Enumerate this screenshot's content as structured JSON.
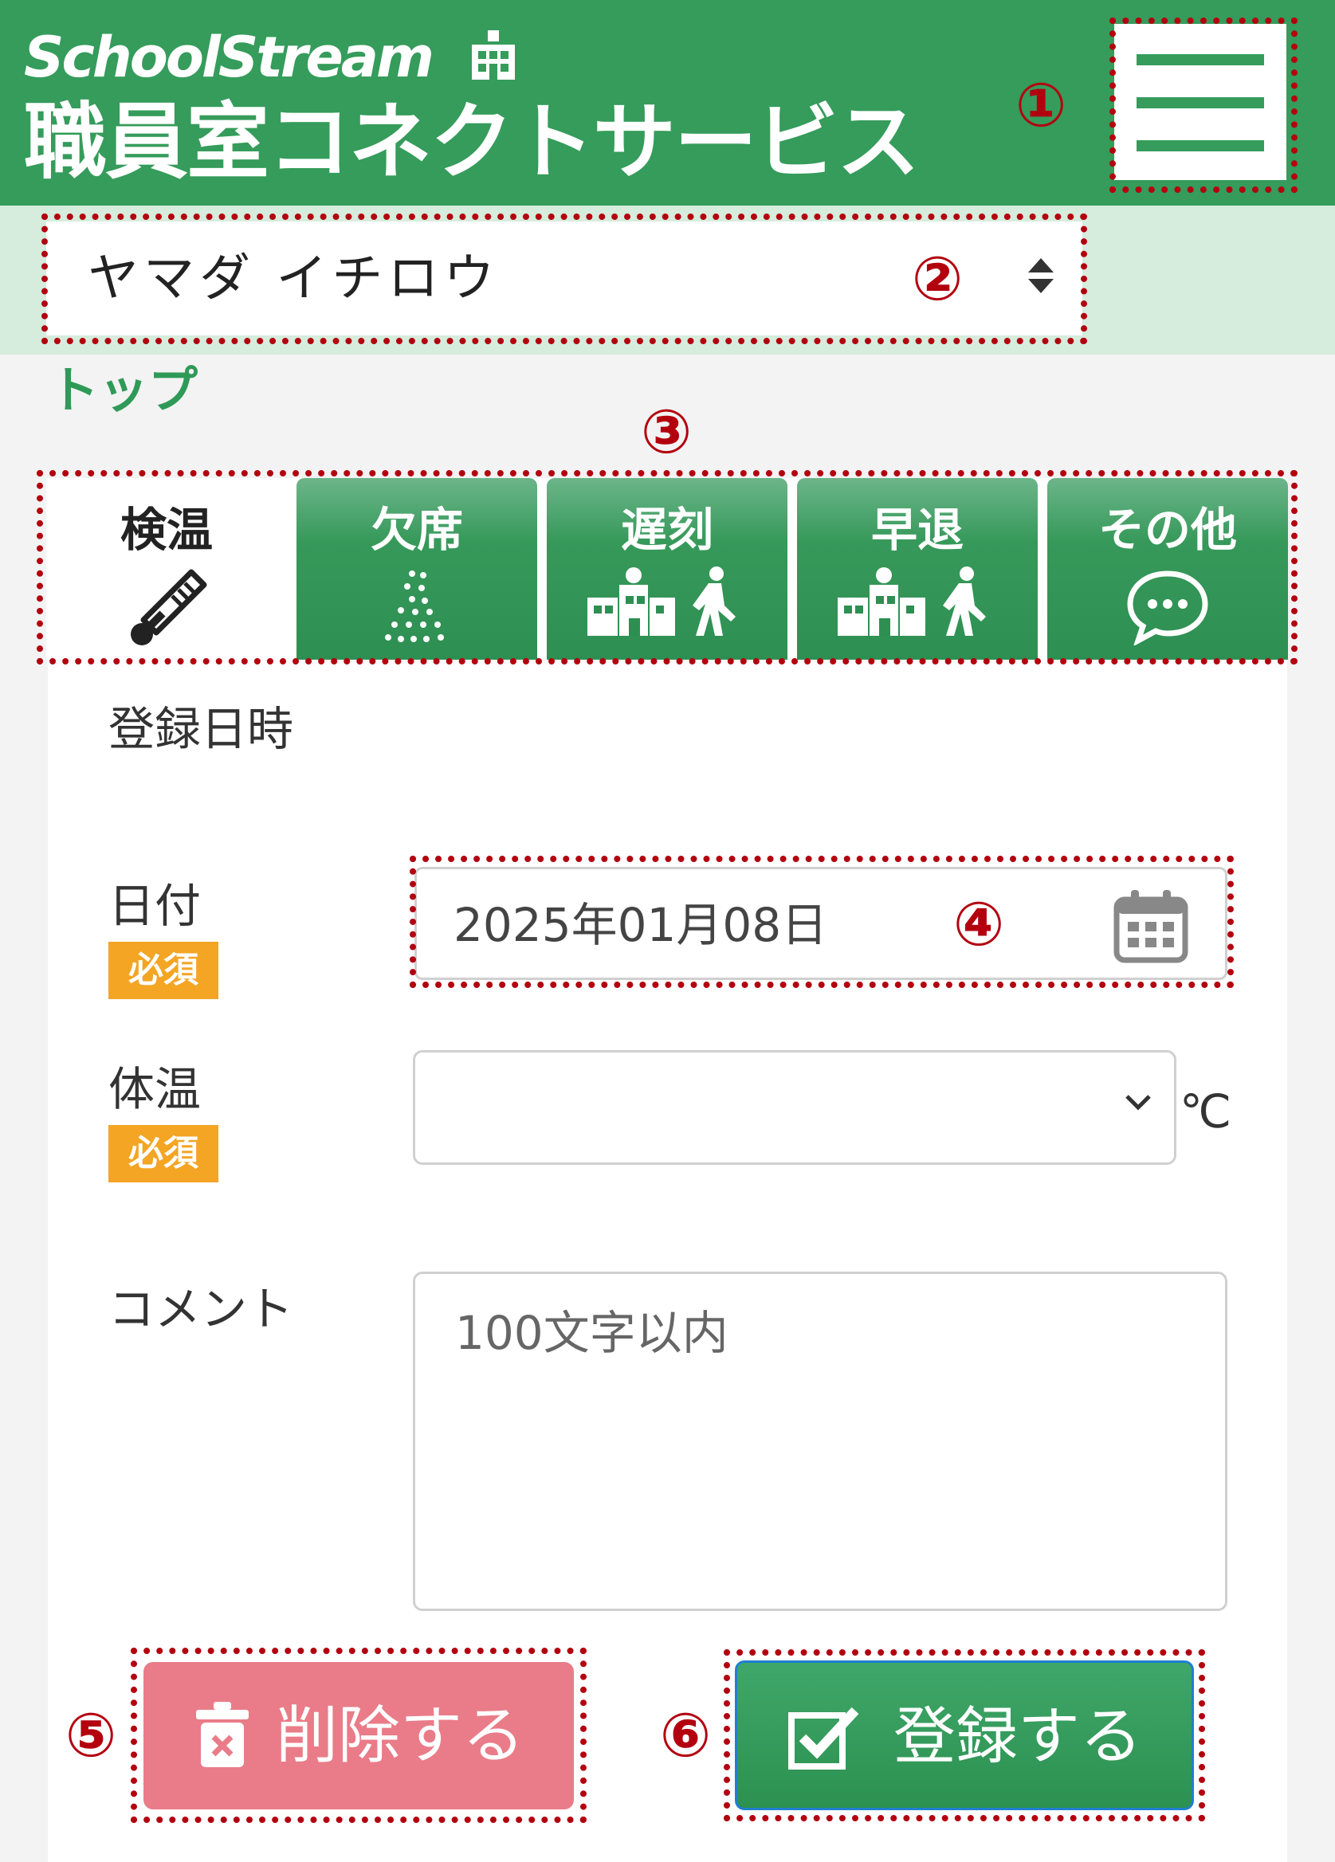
{
  "header": {
    "brand": "SchoolStream",
    "service_name": "職員室コネクトサービス",
    "menu_icon": "hamburger-menu-icon"
  },
  "callouts": [
    "①",
    "②",
    "③",
    "④",
    "⑤",
    "⑥"
  ],
  "user_select": {
    "value": "ヤマダ イチロウ"
  },
  "breadcrumb": "トップ",
  "tabs": [
    {
      "label": "検温",
      "icon": "thermometer-icon",
      "active": true
    },
    {
      "label": "欠席",
      "icon": "absence-dots-icon",
      "active": false
    },
    {
      "label": "遅刻",
      "icon": "school-walking-icon",
      "active": false
    },
    {
      "label": "早退",
      "icon": "school-walking-icon",
      "active": false
    },
    {
      "label": "その他",
      "icon": "speech-bubble-icon",
      "active": false
    }
  ],
  "form": {
    "section_title": "登録日時",
    "date_label": "日付",
    "required_badge": "必須",
    "date_value": "2025年01月08日",
    "temp_label": "体温",
    "temp_unit": "℃",
    "comment_label": "コメント",
    "comment_placeholder": "100文字以内"
  },
  "buttons": {
    "delete_label": "削除する",
    "register_label": "登録する"
  },
  "colors": {
    "brand_green": "#359c5b",
    "callout_red": "#b3000f",
    "badge_orange": "#f4a523",
    "delete_pink": "#e97c88"
  }
}
